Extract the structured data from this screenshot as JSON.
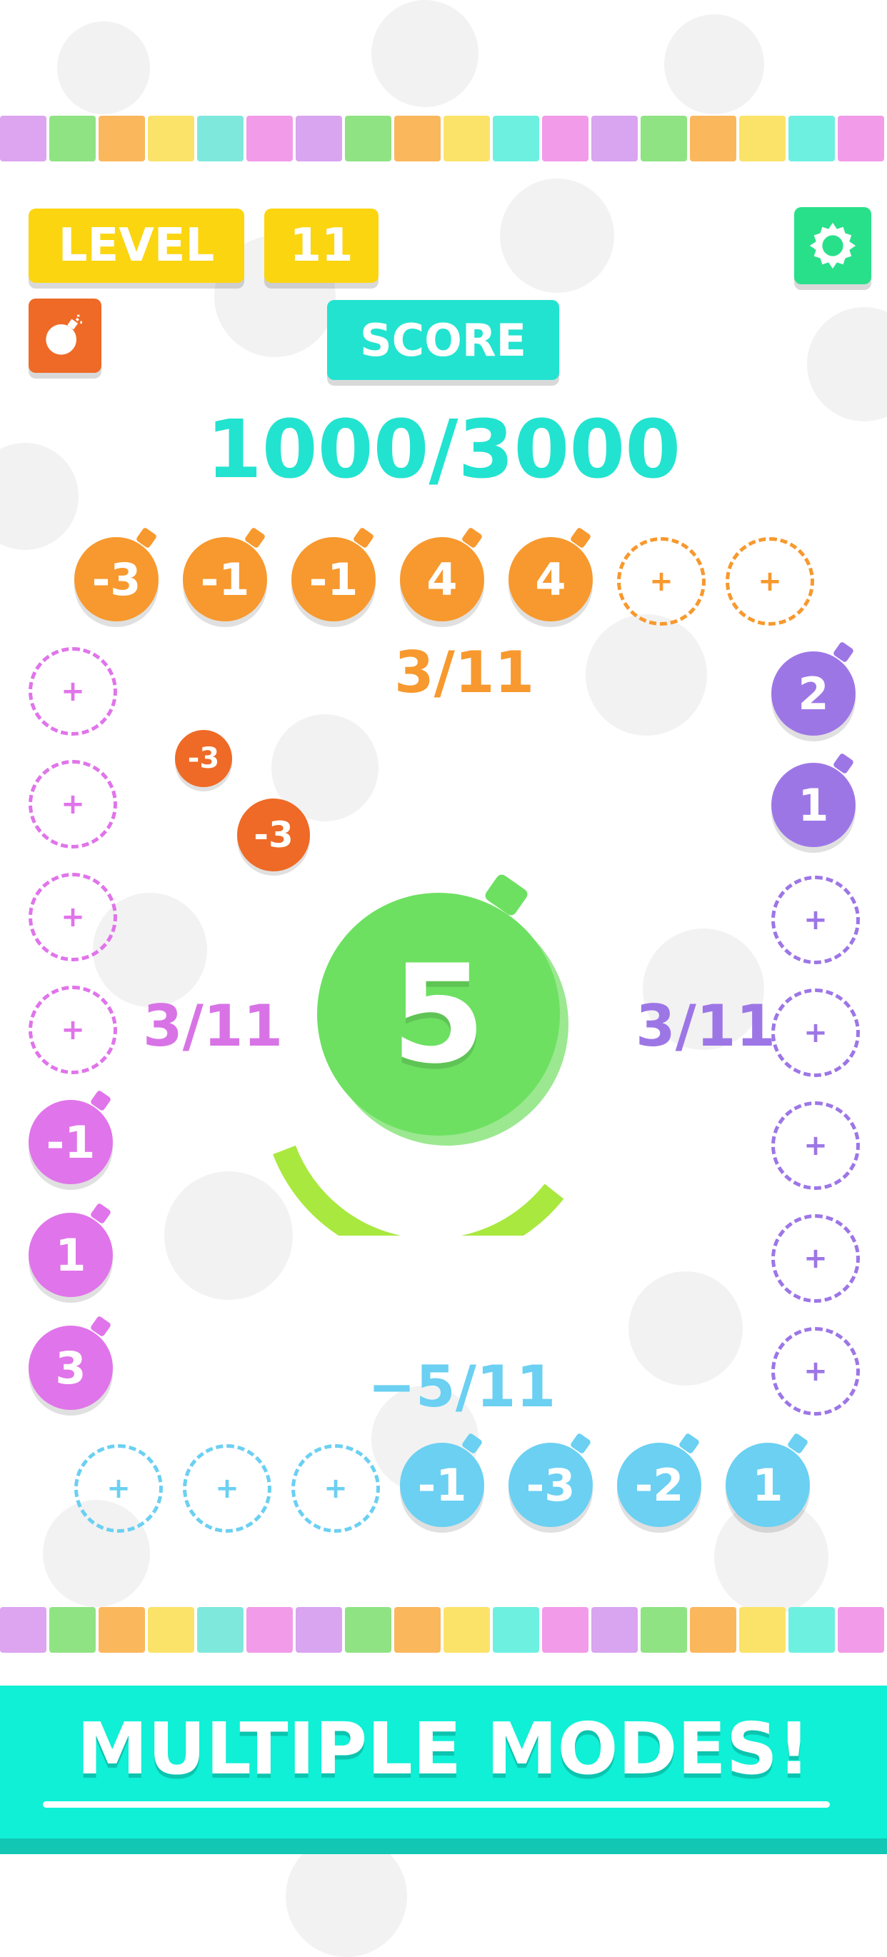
{
  "level": {
    "label": "LEVEL",
    "value": "11"
  },
  "score": {
    "label": "SCORE",
    "value": "1000/3000"
  },
  "icons": {
    "settings": "gear-icon",
    "bomb": "bomb-icon"
  },
  "colors": {
    "orange": "#f7992e",
    "purple_left": "#e074ea",
    "purple_right": "#9d76e6",
    "blue": "#6bd0f2",
    "green": "#6de061",
    "teal": "#22e3cf",
    "yellow": "#fbd510",
    "red_orange": "#ee6a26",
    "lime": "#a9e83f"
  },
  "top_row": {
    "items": [
      "-3",
      "-1",
      "-1",
      "4",
      "4",
      "+",
      "+"
    ],
    "ratio": "3/11"
  },
  "left_column": {
    "items": [
      "+",
      "+",
      "+",
      "+",
      "-1",
      "1",
      "3"
    ],
    "ratio": "3/11"
  },
  "right_column": {
    "items": [
      "2",
      "1",
      "+",
      "+",
      "+",
      "+",
      "+"
    ],
    "ratio": "3/11"
  },
  "bottom_row": {
    "items": [
      "+",
      "+",
      "+",
      "-1",
      "-3",
      "-2",
      "1"
    ],
    "ratio": "−5/11"
  },
  "center_bomb": {
    "value": "5",
    "timer_fraction": 0.25
  },
  "flying_bombs": [
    "-3",
    "-3"
  ],
  "banner": {
    "text": "MULTIPLE MODES!"
  }
}
